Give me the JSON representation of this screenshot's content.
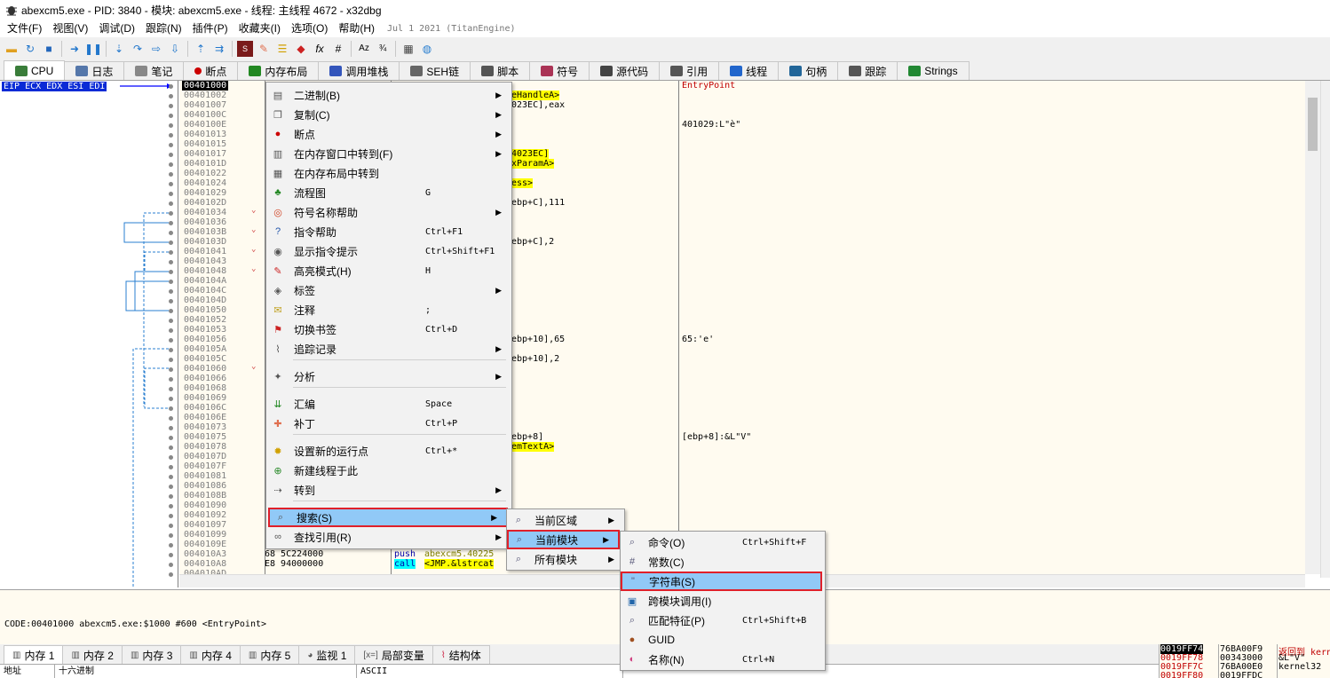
{
  "title": "abexcm5.exe - PID: 3840 - 模块: abexcm5.exe - 线程: 主线程 4672 - x32dbg",
  "menu": [
    "文件(F)",
    "视图(V)",
    "调试(D)",
    "跟踪(N)",
    "插件(P)",
    "收藏夹(I)",
    "选项(O)",
    "帮助(H)"
  ],
  "build_date": "Jul 1 2021 (TitanEngine)",
  "tabs": [
    {
      "label": "CPU",
      "icon": "cpu-icon",
      "color": "#3a7d3a"
    },
    {
      "label": "日志",
      "icon": "log-icon",
      "color": "#5577aa"
    },
    {
      "label": "笔记",
      "icon": "notes-icon",
      "color": "#888888"
    },
    {
      "label": "断点",
      "icon": "breakpoint-icon",
      "color": "#cc0000"
    },
    {
      "label": "内存布局",
      "icon": "memory-map-icon",
      "color": "#228822"
    },
    {
      "label": "调用堆栈",
      "icon": "call-stack-icon",
      "color": "#3355bb"
    },
    {
      "label": "SEH链",
      "icon": "seh-icon",
      "color": "#666666"
    },
    {
      "label": "脚本",
      "icon": "script-icon",
      "color": "#555555"
    },
    {
      "label": "符号",
      "icon": "symbol-icon",
      "color": "#aa3355"
    },
    {
      "label": "源代码",
      "icon": "source-icon",
      "color": "#444444"
    },
    {
      "label": "引用",
      "icon": "references-icon",
      "color": "#555555"
    },
    {
      "label": "线程",
      "icon": "threads-icon",
      "color": "#2266cc"
    },
    {
      "label": "句柄",
      "icon": "handles-icon",
      "color": "#226699"
    },
    {
      "label": "跟踪",
      "icon": "trace-icon",
      "color": "#555555"
    },
    {
      "label": "Strings",
      "icon": "strings-icon",
      "color": "#228833"
    }
  ],
  "registers_label": "EIP ECX EDX ESI EDI",
  "addresses": [
    "00401000",
    "00401002",
    "00401007",
    "0040100C",
    "0040100E",
    "00401013",
    "00401015",
    "00401017",
    "0040101D",
    "00401022",
    "00401024",
    "00401029",
    "0040102D",
    "00401034",
    "00401036",
    "0040103B",
    "0040103D",
    "00401041",
    "00401043",
    "00401048",
    "0040104A",
    "0040104C",
    "0040104D",
    "00401050",
    "00401052",
    "00401053",
    "00401056",
    "0040105A",
    "0040105C",
    "00401060",
    "00401066",
    "00401068",
    "00401069",
    "0040106C",
    "0040106E",
    "00401073",
    "00401075",
    "00401078",
    "0040107D",
    "0040107F",
    "00401081",
    "00401086",
    "0040108B",
    "00401090",
    "00401092",
    "00401097",
    "00401099",
    "0040109E",
    "004010A3",
    "004010A8",
    "004010AD"
  ],
  "code_fragments": [
    {
      "row": 1,
      "text": "eHandleA>",
      "hl": "y"
    },
    {
      "row": 2,
      "text": "023EC],eax",
      "hl": ""
    },
    {
      "row": 7,
      "text": "4023EC]",
      "hl": "y"
    },
    {
      "row": 8,
      "text": "xParamA>",
      "hl": "y"
    },
    {
      "row": 10,
      "text": "ess>",
      "hl": "y"
    },
    {
      "row": 12,
      "text": "ebp+C],111",
      "hl": "c"
    },
    {
      "row": 16,
      "text": "ebp+C],2",
      "hl": "c"
    },
    {
      "row": 26,
      "text": "ebp+10],65",
      "hl": "c"
    },
    {
      "row": 28,
      "text": "ebp+10],2",
      "hl": "c"
    },
    {
      "row": 36,
      "text": "ebp+8]",
      "hl": "c"
    },
    {
      "row": 37,
      "text": "emTextA>",
      "hl": "y"
    }
  ],
  "bytes_rows": [
    {
      "row": 48,
      "bytes": "68 5C224000",
      "instr": "push",
      "operand": "abexcm5.40225"
    },
    {
      "row": 49,
      "bytes": "E8 94000000",
      "instr": "call",
      "operand": "<JMP.&lstrcat"
    }
  ],
  "comments": [
    {
      "row": 0,
      "text": "EntryPoint",
      "red": true
    },
    {
      "row": 4,
      "text": "401029:L\"è\"",
      "red": false
    },
    {
      "row": 26,
      "text": "65:'e'",
      "red": false
    },
    {
      "row": 36,
      "text": "[ebp+8]:&L\"V\"",
      "red": false
    }
  ],
  "context_menu": [
    {
      "label": "二进制(B)",
      "icon": "binary-icon",
      "shortcut": "",
      "submenu": true
    },
    {
      "label": "复制(C)",
      "icon": "copy-icon",
      "shortcut": "",
      "submenu": true
    },
    {
      "label": "断点",
      "icon": "breakpoint-icon",
      "shortcut": "",
      "submenu": true
    },
    {
      "label": "在内存窗口中转到(F)",
      "icon": "dump-icon",
      "shortcut": "",
      "submenu": true
    },
    {
      "label": "在内存布局中转到",
      "icon": "memory-map-icon",
      "shortcut": "",
      "submenu": false
    },
    {
      "label": "流程图",
      "icon": "graph-icon",
      "shortcut": "G",
      "submenu": false
    },
    {
      "label": "符号名称帮助",
      "icon": "help-ring-icon",
      "shortcut": "",
      "submenu": true
    },
    {
      "label": "指令帮助",
      "icon": "question-icon",
      "shortcut": "Ctrl+F1",
      "submenu": false
    },
    {
      "label": "显示指令提示",
      "icon": "hint-icon",
      "shortcut": "Ctrl+Shift+F1",
      "submenu": false
    },
    {
      "label": "高亮模式(H)",
      "icon": "highlight-icon",
      "shortcut": "H",
      "submenu": false
    },
    {
      "label": "标签",
      "icon": "label-icon",
      "shortcut": "",
      "submenu": true
    },
    {
      "label": "注释",
      "icon": "comment-icon",
      "shortcut": ";",
      "submenu": false
    },
    {
      "label": "切换书签",
      "icon": "bookmark-icon",
      "shortcut": "Ctrl+D",
      "submenu": false
    },
    {
      "label": "追踪记录",
      "icon": "trace-record-icon",
      "shortcut": "",
      "submenu": true
    },
    {
      "label": "分析",
      "icon": "analysis-icon",
      "shortcut": "",
      "submenu": true
    },
    {
      "label": "汇编",
      "icon": "assemble-icon",
      "shortcut": "Space",
      "submenu": false
    },
    {
      "label": "补丁",
      "icon": "patch-icon",
      "shortcut": "Ctrl+P",
      "submenu": false
    },
    {
      "label": "设置新的运行点",
      "icon": "run-point-icon",
      "shortcut": "Ctrl+*",
      "submenu": false
    },
    {
      "label": "新建线程于此",
      "icon": "new-thread-icon",
      "shortcut": "",
      "submenu": false
    },
    {
      "label": "转到",
      "icon": "goto-icon",
      "shortcut": "",
      "submenu": true
    },
    {
      "label": "搜索(S)",
      "icon": "search-icon",
      "shortcut": "",
      "submenu": true
    },
    {
      "label": "查找引用(R)",
      "icon": "binoculars-icon",
      "shortcut": "",
      "submenu": true
    }
  ],
  "search_submenu": [
    {
      "label": "当前区域",
      "icon": "search-region-icon"
    },
    {
      "label": "当前模块",
      "icon": "search-module-icon"
    },
    {
      "label": "所有模块",
      "icon": "search-all-icon"
    }
  ],
  "module_submenu": [
    {
      "label": "命令(O)",
      "icon": "command-search-icon",
      "shortcut": "Ctrl+Shift+F"
    },
    {
      "label": "常数(C)",
      "icon": "constant-search-icon",
      "shortcut": ""
    },
    {
      "label": "字符串(S)",
      "icon": "string-search-icon",
      "shortcut": ""
    },
    {
      "label": "跨模块调用(I)",
      "icon": "intermodular-icon",
      "shortcut": ""
    },
    {
      "label": "匹配特征(P)",
      "icon": "pattern-icon",
      "shortcut": "Ctrl+Shift+B"
    },
    {
      "label": "GUID",
      "icon": "guid-icon",
      "shortcut": ""
    },
    {
      "label": "名称(N)",
      "icon": "names-icon",
      "shortcut": "Ctrl+N"
    }
  ],
  "info_line": "CODE:00401000 abexcm5.exe:$1000 #600 <EntryPoint>",
  "bottom_tabs": [
    {
      "label": "内存 1",
      "icon": "dump-icon"
    },
    {
      "label": "内存 2",
      "icon": "dump-icon"
    },
    {
      "label": "内存 3",
      "icon": "dump-icon"
    },
    {
      "label": "内存 4",
      "icon": "dump-icon"
    },
    {
      "label": "内存 5",
      "icon": "dump-icon"
    },
    {
      "label": "监视 1",
      "icon": "watch-icon"
    },
    {
      "label": "局部变量",
      "icon": "locals-icon"
    },
    {
      "label": "结构体",
      "icon": "struct-icon"
    }
  ],
  "dump_headers": [
    "地址",
    "十六进制",
    "ASCII"
  ],
  "stack_rows": [
    {
      "addr": "0019FF74",
      "value": "76BA00F9",
      "comment": "返回到 kerne"
    },
    {
      "addr": "0019FF78",
      "value": "00343000",
      "comment": "&L\"V\""
    },
    {
      "addr": "0019FF7C",
      "value": "76BA00E0",
      "comment": "kernel32"
    },
    {
      "addr": "0019FF80",
      "value": "0019FFDC",
      "comment": ""
    }
  ]
}
